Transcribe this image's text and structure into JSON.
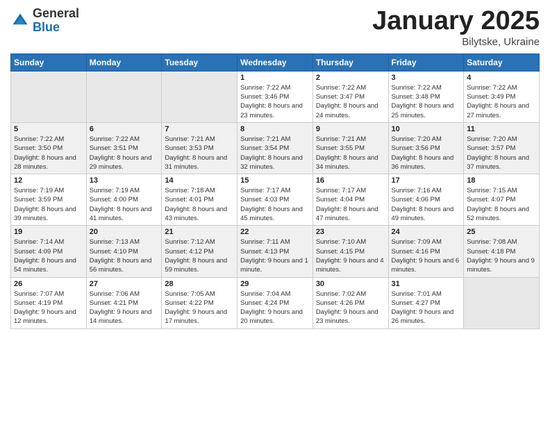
{
  "header": {
    "logo_general": "General",
    "logo_blue": "Blue",
    "month_year": "January 2025",
    "location": "Bilytske, Ukraine"
  },
  "weekdays": [
    "Sunday",
    "Monday",
    "Tuesday",
    "Wednesday",
    "Thursday",
    "Friday",
    "Saturday"
  ],
  "weeks": [
    [
      {
        "day": "",
        "empty": true
      },
      {
        "day": "",
        "empty": true
      },
      {
        "day": "",
        "empty": true
      },
      {
        "day": "1",
        "sunrise": "Sunrise: 7:22 AM",
        "sunset": "Sunset: 3:46 PM",
        "daylight": "Daylight: 8 hours and 23 minutes."
      },
      {
        "day": "2",
        "sunrise": "Sunrise: 7:22 AM",
        "sunset": "Sunset: 3:47 PM",
        "daylight": "Daylight: 8 hours and 24 minutes."
      },
      {
        "day": "3",
        "sunrise": "Sunrise: 7:22 AM",
        "sunset": "Sunset: 3:48 PM",
        "daylight": "Daylight: 8 hours and 25 minutes."
      },
      {
        "day": "4",
        "sunrise": "Sunrise: 7:22 AM",
        "sunset": "Sunset: 3:49 PM",
        "daylight": "Daylight: 8 hours and 27 minutes."
      }
    ],
    [
      {
        "day": "5",
        "sunrise": "Sunrise: 7:22 AM",
        "sunset": "Sunset: 3:50 PM",
        "daylight": "Daylight: 8 hours and 28 minutes."
      },
      {
        "day": "6",
        "sunrise": "Sunrise: 7:22 AM",
        "sunset": "Sunset: 3:51 PM",
        "daylight": "Daylight: 8 hours and 29 minutes."
      },
      {
        "day": "7",
        "sunrise": "Sunrise: 7:21 AM",
        "sunset": "Sunset: 3:53 PM",
        "daylight": "Daylight: 8 hours and 31 minutes."
      },
      {
        "day": "8",
        "sunrise": "Sunrise: 7:21 AM",
        "sunset": "Sunset: 3:54 PM",
        "daylight": "Daylight: 8 hours and 32 minutes."
      },
      {
        "day": "9",
        "sunrise": "Sunrise: 7:21 AM",
        "sunset": "Sunset: 3:55 PM",
        "daylight": "Daylight: 8 hours and 34 minutes."
      },
      {
        "day": "10",
        "sunrise": "Sunrise: 7:20 AM",
        "sunset": "Sunset: 3:56 PM",
        "daylight": "Daylight: 8 hours and 36 minutes."
      },
      {
        "day": "11",
        "sunrise": "Sunrise: 7:20 AM",
        "sunset": "Sunset: 3:57 PM",
        "daylight": "Daylight: 8 hours and 37 minutes."
      }
    ],
    [
      {
        "day": "12",
        "sunrise": "Sunrise: 7:19 AM",
        "sunset": "Sunset: 3:59 PM",
        "daylight": "Daylight: 8 hours and 39 minutes."
      },
      {
        "day": "13",
        "sunrise": "Sunrise: 7:19 AM",
        "sunset": "Sunset: 4:00 PM",
        "daylight": "Daylight: 8 hours and 41 minutes."
      },
      {
        "day": "14",
        "sunrise": "Sunrise: 7:18 AM",
        "sunset": "Sunset: 4:01 PM",
        "daylight": "Daylight: 8 hours and 43 minutes."
      },
      {
        "day": "15",
        "sunrise": "Sunrise: 7:17 AM",
        "sunset": "Sunset: 4:03 PM",
        "daylight": "Daylight: 8 hours and 45 minutes."
      },
      {
        "day": "16",
        "sunrise": "Sunrise: 7:17 AM",
        "sunset": "Sunset: 4:04 PM",
        "daylight": "Daylight: 8 hours and 47 minutes."
      },
      {
        "day": "17",
        "sunrise": "Sunrise: 7:16 AM",
        "sunset": "Sunset: 4:06 PM",
        "daylight": "Daylight: 8 hours and 49 minutes."
      },
      {
        "day": "18",
        "sunrise": "Sunrise: 7:15 AM",
        "sunset": "Sunset: 4:07 PM",
        "daylight": "Daylight: 8 hours and 52 minutes."
      }
    ],
    [
      {
        "day": "19",
        "sunrise": "Sunrise: 7:14 AM",
        "sunset": "Sunset: 4:09 PM",
        "daylight": "Daylight: 8 hours and 54 minutes."
      },
      {
        "day": "20",
        "sunrise": "Sunrise: 7:13 AM",
        "sunset": "Sunset: 4:10 PM",
        "daylight": "Daylight: 8 hours and 56 minutes."
      },
      {
        "day": "21",
        "sunrise": "Sunrise: 7:12 AM",
        "sunset": "Sunset: 4:12 PM",
        "daylight": "Daylight: 8 hours and 59 minutes."
      },
      {
        "day": "22",
        "sunrise": "Sunrise: 7:11 AM",
        "sunset": "Sunset: 4:13 PM",
        "daylight": "Daylight: 9 hours and 1 minute."
      },
      {
        "day": "23",
        "sunrise": "Sunrise: 7:10 AM",
        "sunset": "Sunset: 4:15 PM",
        "daylight": "Daylight: 9 hours and 4 minutes."
      },
      {
        "day": "24",
        "sunrise": "Sunrise: 7:09 AM",
        "sunset": "Sunset: 4:16 PM",
        "daylight": "Daylight: 9 hours and 6 minutes."
      },
      {
        "day": "25",
        "sunrise": "Sunrise: 7:08 AM",
        "sunset": "Sunset: 4:18 PM",
        "daylight": "Daylight: 9 hours and 9 minutes."
      }
    ],
    [
      {
        "day": "26",
        "sunrise": "Sunrise: 7:07 AM",
        "sunset": "Sunset: 4:19 PM",
        "daylight": "Daylight: 9 hours and 12 minutes."
      },
      {
        "day": "27",
        "sunrise": "Sunrise: 7:06 AM",
        "sunset": "Sunset: 4:21 PM",
        "daylight": "Daylight: 9 hours and 14 minutes."
      },
      {
        "day": "28",
        "sunrise": "Sunrise: 7:05 AM",
        "sunset": "Sunset: 4:22 PM",
        "daylight": "Daylight: 9 hours and 17 minutes."
      },
      {
        "day": "29",
        "sunrise": "Sunrise: 7:04 AM",
        "sunset": "Sunset: 4:24 PM",
        "daylight": "Daylight: 9 hours and 20 minutes."
      },
      {
        "day": "30",
        "sunrise": "Sunrise: 7:02 AM",
        "sunset": "Sunset: 4:26 PM",
        "daylight": "Daylight: 9 hours and 23 minutes."
      },
      {
        "day": "31",
        "sunrise": "Sunrise: 7:01 AM",
        "sunset": "Sunset: 4:27 PM",
        "daylight": "Daylight: 9 hours and 26 minutes."
      },
      {
        "day": "",
        "empty": true
      }
    ]
  ]
}
